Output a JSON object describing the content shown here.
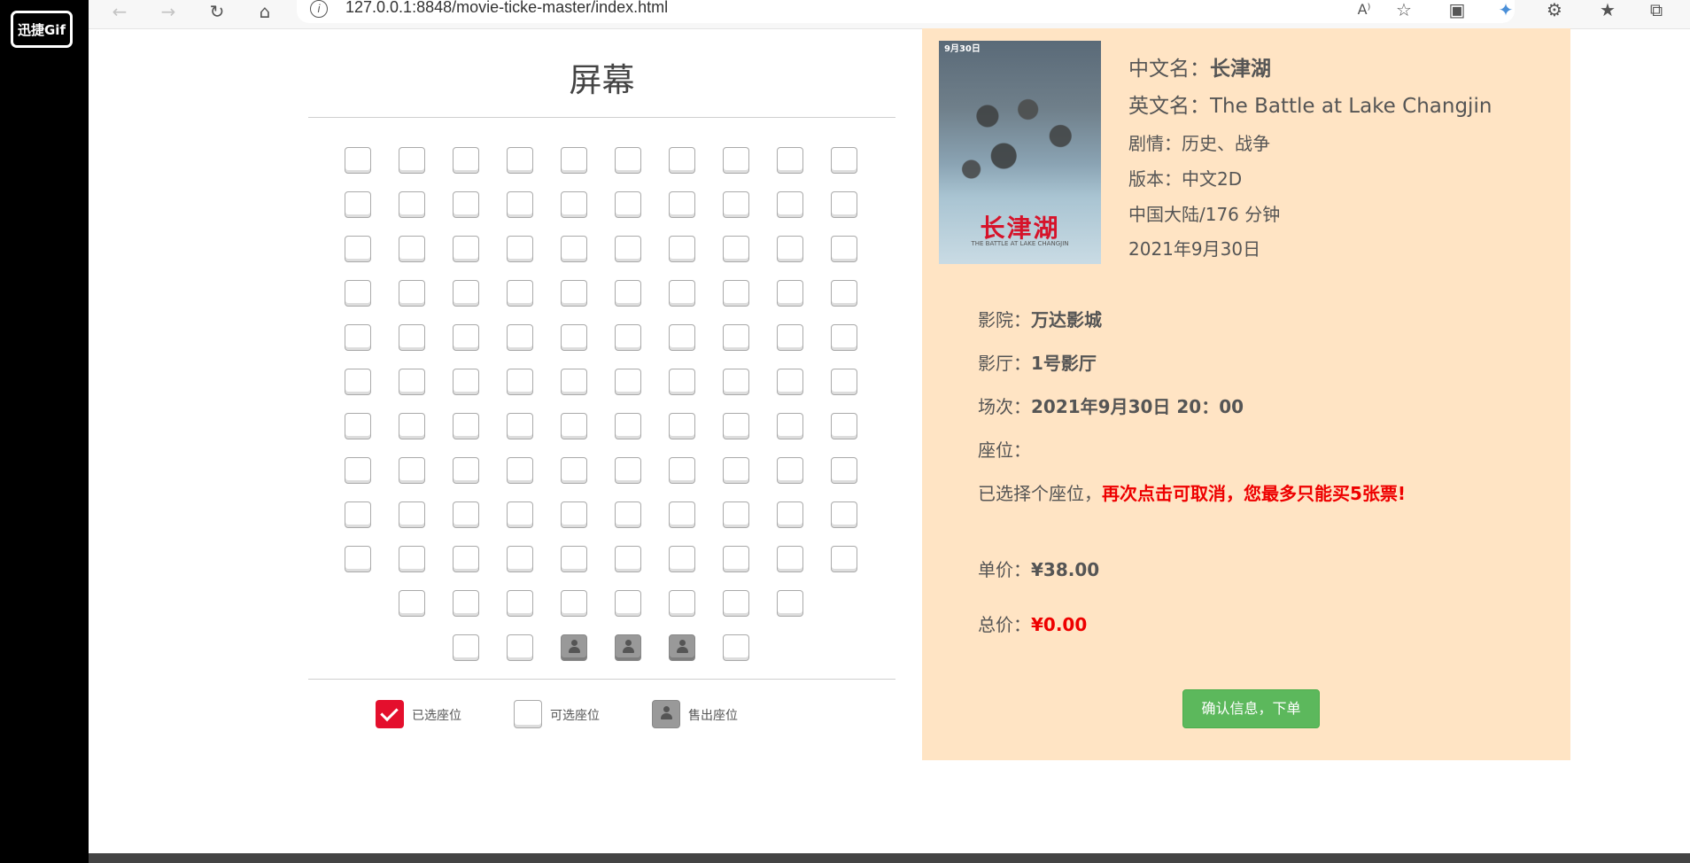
{
  "app": {
    "logo_text": "迅捷Gif"
  },
  "browser": {
    "url": "127.0.0.1:8848/movie-ticke-master/index.html",
    "icons": [
      "back-icon",
      "forward-icon",
      "reload-icon",
      "home-icon",
      "info-icon",
      "read-aloud-icon",
      "add-favorite-icon",
      "extension-icon",
      "bird-extension-icon",
      "puzzle-icon",
      "favorites-icon",
      "collections-icon"
    ]
  },
  "cinema": {
    "screen_label": "屏幕",
    "seat_rows": [
      {
        "count": 10,
        "sold": []
      },
      {
        "count": 10,
        "sold": []
      },
      {
        "count": 10,
        "sold": []
      },
      {
        "count": 10,
        "sold": []
      },
      {
        "count": 10,
        "sold": []
      },
      {
        "count": 10,
        "sold": []
      },
      {
        "count": 10,
        "sold": []
      },
      {
        "count": 10,
        "sold": []
      },
      {
        "count": 10,
        "sold": []
      },
      {
        "count": 10,
        "sold": []
      },
      {
        "count": 8,
        "sold": []
      },
      {
        "count": 6,
        "sold": [
          2,
          3,
          4
        ]
      }
    ],
    "legend": {
      "selected": "已选座位",
      "available": "可选座位",
      "sold": "售出座位"
    }
  },
  "movie": {
    "poster": {
      "date_badge": "9月30日",
      "title_text": "长津湖",
      "sub_text": "THE BATTLE AT LAKE CHANGJIN"
    },
    "cn_name_label": "中文名：",
    "cn_name": "长津湖",
    "en_name_label": "英文名：",
    "en_name": "The Battle at Lake Changjin",
    "genre": "剧情：历史、战争",
    "version": "版本：中文2D",
    "region_runtime": "中国大陆/176 分钟",
    "release_date": "2021年9月30日"
  },
  "order": {
    "cinema_label": "影院：",
    "cinema_value": "万达影城",
    "hall_label": "影厅：",
    "hall_value": "1号影厅",
    "session_label": "场次：",
    "session_value": "2021年9月30日 20：00",
    "seats_label": "座位：",
    "selected_hint": "已选择个座位，",
    "warning": "再次点击可取消，您最多只能买5张票!",
    "unit_price_label": "单价：",
    "unit_price": "¥38.00",
    "total_label": "总价：",
    "total_price": "¥0.00",
    "confirm_button": "确认信息，下单"
  },
  "colors": {
    "panel_bg": "#ffe4c4",
    "selected_seat": "#e40f2d",
    "sold_seat": "#999999",
    "confirm_button": "#5cb85c",
    "warning": "#ee0000"
  }
}
